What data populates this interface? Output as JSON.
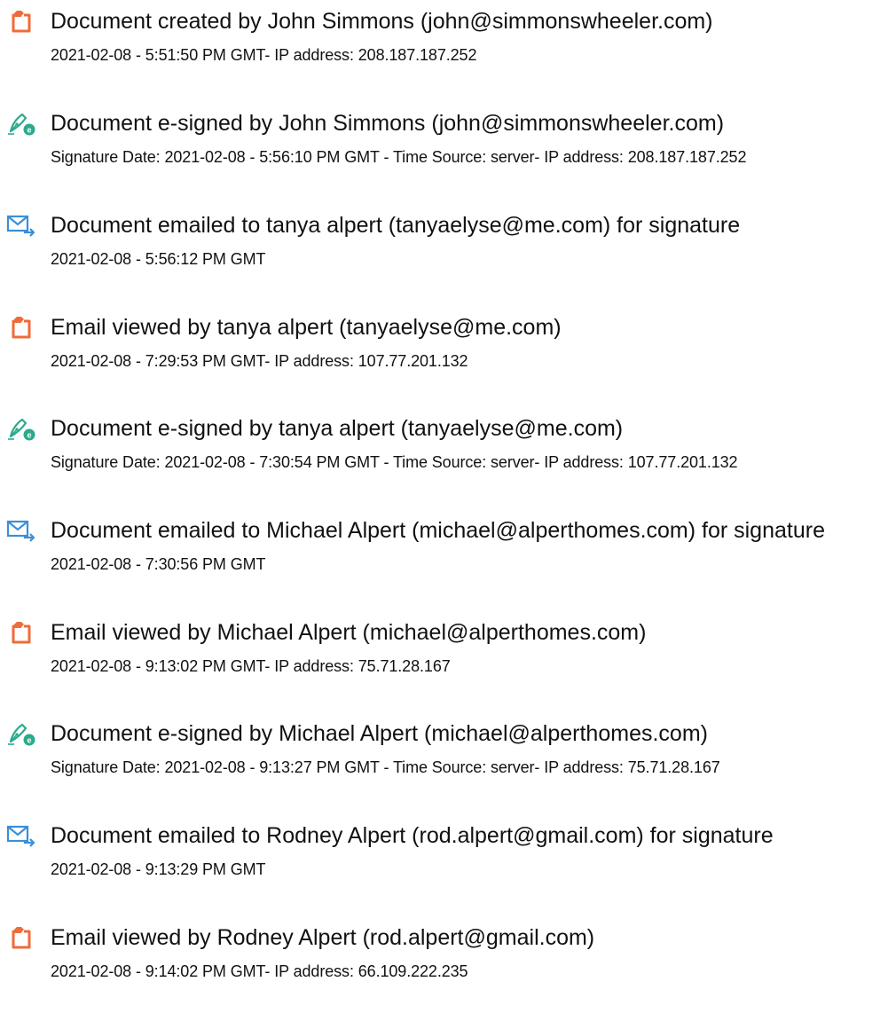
{
  "colors": {
    "created_viewed_icon": "#ee6b3a",
    "signed_icon": "#2baa8c",
    "emailed_icon": "#3b8fd9"
  },
  "events": [
    {
      "icon": "document-icon",
      "title": "Document created by John Simmons (john@simmonswheeler.com)",
      "detail": "2021-02-08 - 5:51:50 PM GMT- IP address: 208.187.187.252"
    },
    {
      "icon": "e-sign-pen-icon",
      "title": "Document e-signed by John Simmons (john@simmonswheeler.com)",
      "detail": "Signature Date: 2021-02-08 - 5:56:10 PM GMT - Time Source: server- IP address: 208.187.187.252"
    },
    {
      "icon": "email-send-icon",
      "title": "Document emailed to tanya alpert (tanyaelyse@me.com) for signature",
      "detail": "2021-02-08 - 5:56:12 PM GMT"
    },
    {
      "icon": "document-icon",
      "title": "Email viewed by tanya alpert (tanyaelyse@me.com)",
      "detail": "2021-02-08 - 7:29:53 PM GMT- IP address: 107.77.201.132"
    },
    {
      "icon": "e-sign-pen-icon",
      "title": "Document e-signed by tanya alpert (tanyaelyse@me.com)",
      "detail": "Signature Date: 2021-02-08 - 7:30:54 PM GMT - Time Source: server- IP address: 107.77.201.132"
    },
    {
      "icon": "email-send-icon",
      "title": "Document emailed to Michael Alpert (michael@alperthomes.com) for signature",
      "detail": "2021-02-08 - 7:30:56 PM GMT"
    },
    {
      "icon": "document-icon",
      "title": "Email viewed by Michael Alpert (michael@alperthomes.com)",
      "detail": "2021-02-08 - 9:13:02 PM GMT- IP address: 75.71.28.167"
    },
    {
      "icon": "e-sign-pen-icon",
      "title": "Document e-signed by Michael Alpert (michael@alperthomes.com)",
      "detail": "Signature Date: 2021-02-08 - 9:13:27 PM GMT - Time Source: server- IP address: 75.71.28.167"
    },
    {
      "icon": "email-send-icon",
      "title": "Document emailed to Rodney Alpert (rod.alpert@gmail.com) for signature",
      "detail": "2021-02-08 - 9:13:29 PM GMT"
    },
    {
      "icon": "document-icon",
      "title": "Email viewed by Rodney Alpert (rod.alpert@gmail.com)",
      "detail": "2021-02-08 - 9:14:02 PM GMT- IP address: 66.109.222.235"
    }
  ]
}
